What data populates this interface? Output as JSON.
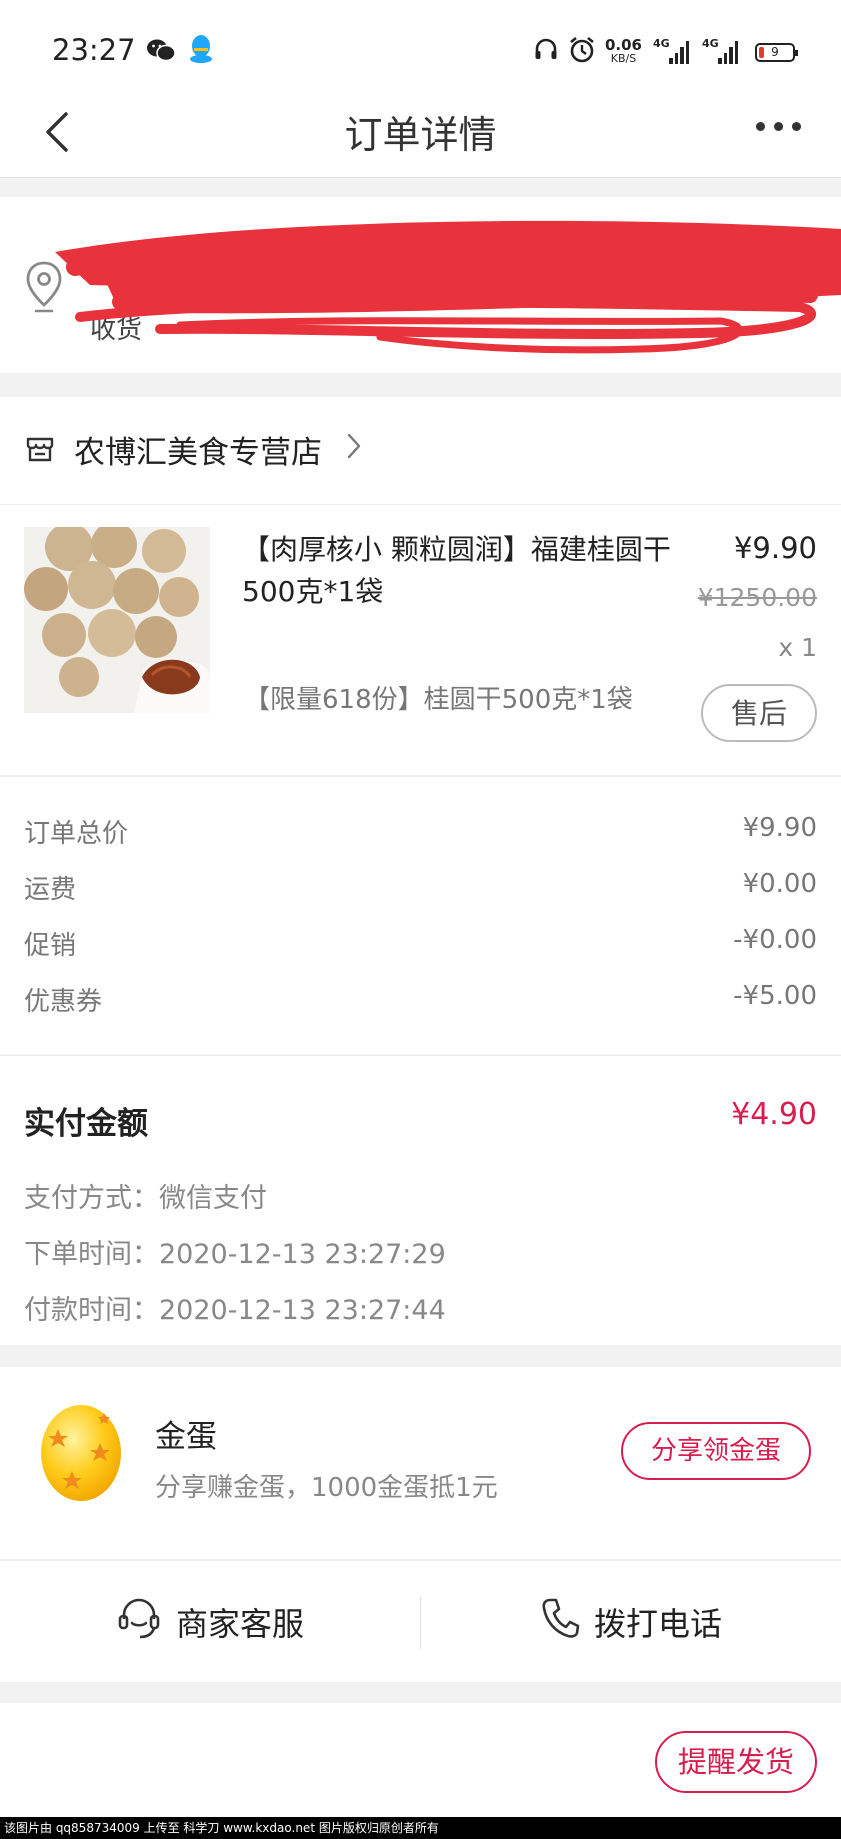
{
  "status_bar": {
    "time": "23:27",
    "speed_value": "0.06",
    "speed_unit": "KB/S",
    "signal1_label": "4G",
    "signal2_label": "4G",
    "battery_level": "9",
    "icons": [
      "wechat-icon",
      "qq-icon",
      "headset-icon",
      "alarm-icon",
      "signal-icon",
      "battery-icon"
    ]
  },
  "nav": {
    "title": "订单详情"
  },
  "address": {
    "line1_visible": "收",
    "line2_visible": "收货"
  },
  "store": {
    "name": "农博汇美食专营店",
    "product": {
      "name": "【肉厚核小 颗粒圆润】福建桂圆干500克*1袋",
      "price": "¥9.90",
      "original_price": "¥1250.00",
      "quantity": "x 1",
      "spec": "【限量618份】桂圆干500克*1袋",
      "after_sale_label": "售后"
    }
  },
  "fees": [
    {
      "label": "订单总价",
      "value": "¥9.90"
    },
    {
      "label": "运费",
      "value": "¥0.00"
    },
    {
      "label": "促销",
      "value": "-¥0.00"
    },
    {
      "label": "优惠券",
      "value": "-¥5.00"
    }
  ],
  "payment": {
    "paid_label": "实付金额",
    "paid_amount": "¥4.90",
    "method": "支付方式：微信支付",
    "order_time": "下单时间：2020-12-13 23:27:29",
    "pay_time": "付款时间：2020-12-13 23:27:44"
  },
  "golden_egg": {
    "title": "金蛋",
    "subtitle": "分享赚金蛋，1000金蛋抵1元",
    "button": "分享领金蛋"
  },
  "contact": {
    "service": "商家客服",
    "call": "拨打电话"
  },
  "bottom": {
    "remind_button": "提醒发货"
  },
  "watermark": "该图片由 qq858734009 上传至 科学刀 www.kxdao.net 图片版权归原创者所有",
  "colors": {
    "accent": "#d81e4f",
    "redaction": "#e8323c",
    "background": "#f2f2f2"
  }
}
